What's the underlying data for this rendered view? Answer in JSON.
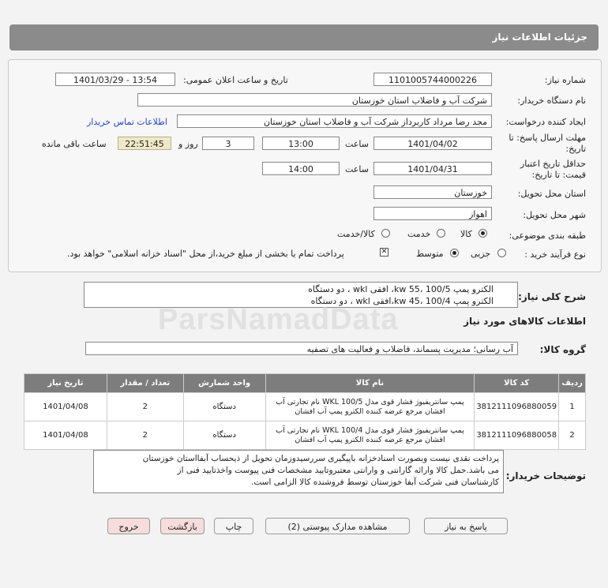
{
  "header": {
    "title": "جزئیات اطلاعات نیاز"
  },
  "form": {
    "need_number_label": "شماره نیاز:",
    "need_number": "1101005744000226",
    "announce_label": "تاریخ و ساعت اعلان عمومی:",
    "announce_value": "1401/03/29 - 13:54",
    "buyer_label": "نام دستگاه خریدار:",
    "buyer": "شرکت آب و فاضلاب استان خوزستان",
    "creator_label": "ایجاد کننده درخواست:",
    "creator": "مجد رضا مرداد کاربرداز شرکت آب و فاضلاب استان خوزستان",
    "contact_link": "اطلاعات تماس خریدار",
    "deadline_label_1": "مهلت ارسال پاسخ: تا",
    "deadline_label_2": "تاریخ:",
    "deadline_date": "1401/04/02",
    "time_label": "ساعت",
    "deadline_time": "13:00",
    "days": "3",
    "days_label": "روز و",
    "remaining": "22:51:45",
    "remaining_label": "ساعت باقی مانده",
    "validity_label_1": "حداقل تاریخ اعتبار",
    "validity_label_2": "قیمت: تا تاریخ:",
    "validity_date": "1401/04/31",
    "validity_time": "14:00",
    "province_label": "استان محل تحویل:",
    "province": "خوزستان",
    "city_label": "شهر محل تحویل:",
    "city": "اهواز",
    "category_label": "طبقه بندی موضوعی:",
    "category_options": [
      "کالا",
      "خدمت",
      "کالا/خدمت"
    ],
    "process_label": "نوع فرآیند خرید :",
    "process_options": [
      "جزیی",
      "متوسط"
    ],
    "payment_note": "پرداخت تمام یا بخشی از مبلغ خرید،از محل \"اسناد خزانه اسلامی\" خواهد بود."
  },
  "summary": {
    "label": "شرح کلی نیاز:",
    "line1": "الکترو پمپ kw 55، 100/5، افقی wkl ، دو دستگاه",
    "line2": "الکترو پمپ kw 45، 100/4،افقی wkl ، دو دستگاه"
  },
  "watermark": "ParsNamadData",
  "goods": {
    "section_title": "اطلاعات کالاهای مورد نیاز",
    "group_label": "گروه کالا:",
    "group_value": "آب رسانی؛ مدیریت پسماند، فاضلاب و فعالیت های تصفیه",
    "columns": [
      "ردیف",
      "کد کالا",
      "نام کالا",
      "واحد شمارش",
      "تعداد / مقدار",
      "تاریخ نیاز"
    ],
    "rows": [
      {
        "idx": "1",
        "code": "3812111096880059",
        "name_l1": "پمپ سانتریفیوژ فشار قوی مدل WKL 100/5 نام تجارتی آب",
        "name_l2": "افشان مرجع عرضه کننده الکترو پمپ آب افشان",
        "unit": "دستگاه",
        "qty": "2",
        "date": "1401/04/08"
      },
      {
        "idx": "2",
        "code": "3812111096880058",
        "name_l1": "پمپ سانتریفیوژ فشار قوی مدل WKL 100/4 نام تجارتی آب",
        "name_l2": "افشان مرجع عرضه کننده الکترو پمپ آب افشان",
        "unit": "دستگاه",
        "qty": "2",
        "date": "1401/04/08"
      }
    ]
  },
  "buyer_notes": {
    "label": "توضیحات خریدار:",
    "line1": "پرداخت نقدی نیست وبصورت اسنادخزانه باپیگیری سررسیدوزمان تحویل از ذیحساب آبفااستان خوزستان",
    "line2": "می باشد.حمل کالا وارائه گارانتی و وارانتی معتبروتایید مشخصات فنی پیوست واخذتایید فنی از",
    "line3": "کارشناسان فنی شرکت آبفا خوزستان توسط فروشنده کالا الزامی است."
  },
  "buttons": {
    "reply": "پاسخ به نیاز",
    "docs": "مشاهده مدارک پیوستی (2)",
    "print": "چاپ",
    "back": "بازگشت",
    "exit": "خروج"
  }
}
